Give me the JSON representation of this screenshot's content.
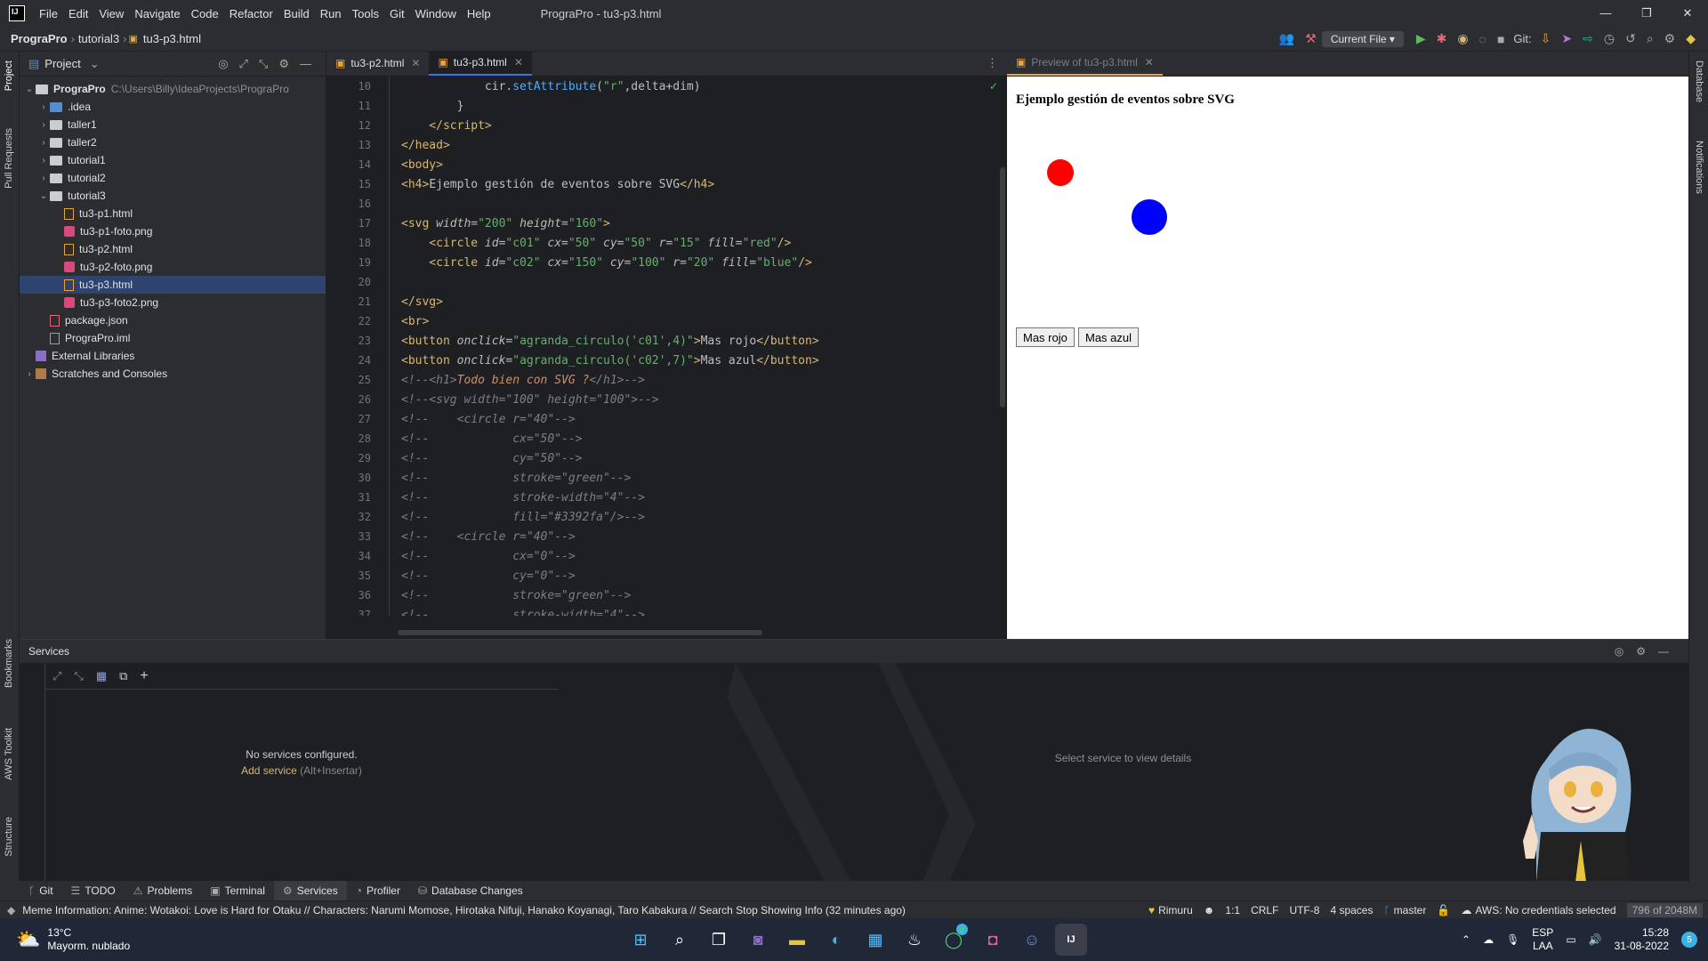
{
  "window": {
    "menu": [
      "File",
      "Edit",
      "View",
      "Navigate",
      "Code",
      "Refactor",
      "Build",
      "Run",
      "Tools",
      "Git",
      "Window",
      "Help"
    ],
    "title": "PrograPro - tu3-p3.html"
  },
  "nav": {
    "breadcrumb": [
      "PrograPro",
      "tutorial3",
      "tu3-p3.html"
    ],
    "run_config": "Current File",
    "git_label": "Git:"
  },
  "left_stripe": [
    "Project",
    "Pull Requests",
    "Bookmarks",
    "AWS Toolkit",
    "Structure"
  ],
  "right_stripe": [
    "Database",
    "Notifications"
  ],
  "project": {
    "header": "Project",
    "root": {
      "name": "PrograPro",
      "path": "C:\\Users\\Billy\\IdeaProjects\\PrograPro"
    },
    "items": [
      {
        "name": ".idea",
        "type": "folder-blue",
        "level": 1,
        "arrow": "›"
      },
      {
        "name": "taller1",
        "type": "folder",
        "level": 1,
        "arrow": "›"
      },
      {
        "name": "taller2",
        "type": "folder",
        "level": 1,
        "arrow": "›"
      },
      {
        "name": "tutorial1",
        "type": "folder",
        "level": 1,
        "arrow": "›"
      },
      {
        "name": "tutorial2",
        "type": "folder",
        "level": 1,
        "arrow": "›"
      },
      {
        "name": "tutorial3",
        "type": "folder",
        "level": 1,
        "arrow": "⌄"
      },
      {
        "name": "tu3-p1.html",
        "type": "html",
        "level": 2,
        "arrow": ""
      },
      {
        "name": "tu3-p1-foto.png",
        "type": "img",
        "level": 2,
        "arrow": ""
      },
      {
        "name": "tu3-p2.html",
        "type": "html",
        "level": 2,
        "arrow": ""
      },
      {
        "name": "tu3-p2-foto.png",
        "type": "img",
        "level": 2,
        "arrow": ""
      },
      {
        "name": "tu3-p3.html",
        "type": "html",
        "level": 2,
        "arrow": "",
        "selected": true
      },
      {
        "name": "tu3-p3-foto2.png",
        "type": "img",
        "level": 2,
        "arrow": ""
      },
      {
        "name": "package.json",
        "type": "json",
        "level": 1,
        "arrow": ""
      },
      {
        "name": "PrograPro.iml",
        "type": "iml",
        "level": 1,
        "arrow": ""
      },
      {
        "name": "External Libraries",
        "type": "lib",
        "level": 0,
        "arrow": ""
      },
      {
        "name": "Scratches and Consoles",
        "type": "scr",
        "level": 0,
        "arrow": "›"
      }
    ]
  },
  "editor": {
    "tabs": [
      {
        "label": "tu3-p2.html"
      },
      {
        "label": "tu3-p3.html",
        "active": true
      }
    ],
    "lines": [
      {
        "n": "10",
        "html": "<span class='js'>            cir.</span><span class='fn'>setAttribute</span><span class='js'>(</span><span class='str'>\"r\"</span><span class='js'>,delta+dim)</span>"
      },
      {
        "n": "11",
        "html": "<span class='js'>        }</span>"
      },
      {
        "n": "12",
        "html": "<span class='tag'>    &lt;/script&gt;</span>"
      },
      {
        "n": "13",
        "html": "<span class='tag'>&lt;/head&gt;</span>"
      },
      {
        "n": "14",
        "html": "<span class='tag'>&lt;body&gt;</span>"
      },
      {
        "n": "15",
        "html": "<span class='tag'>&lt;h4&gt;</span><span class='txt'>Ejemplo gestión de eventos sobre SVG</span><span class='tag'>&lt;/h4&gt;</span>"
      },
      {
        "n": "16",
        "html": ""
      },
      {
        "n": "17",
        "html": "<span class='tag'>&lt;svg </span><span class='attr'>width=</span><span class='str'>\"200\"</span><span class='attr'> height=</span><span class='str'>\"160\"</span><span class='tag'>&gt;</span>"
      },
      {
        "n": "18",
        "html": "<span class='tag'>    &lt;circle </span><span class='attr'>id=</span><span class='str'>\"c01\"</span><span class='attr'> cx=</span><span class='str'>\"50\"</span><span class='attr'> cy=</span><span class='str'>\"50\"</span><span class='attr'> r=</span><span class='str'>\"15\"</span><span class='attr'> fill=</span><span class='str'>\"red\"</span><span class='tag'>/&gt;</span>"
      },
      {
        "n": "19",
        "html": "<span class='tag'>    &lt;circle </span><span class='attr'>id=</span><span class='str'>\"c02\"</span><span class='attr'> cx=</span><span class='str'>\"150\"</span><span class='attr'> cy=</span><span class='str'>\"100\"</span><span class='attr'> r=</span><span class='str'>\"20\"</span><span class='attr'> fill=</span><span class='str'>\"blue\"</span><span class='tag'>/&gt;</span>"
      },
      {
        "n": "20",
        "html": ""
      },
      {
        "n": "21",
        "html": "<span class='tag'>&lt;/svg&gt;</span>"
      },
      {
        "n": "22",
        "html": "<span class='tag'>&lt;br&gt;</span>"
      },
      {
        "n": "23",
        "html": "<span class='tag'>&lt;button </span><span class='attr'>onclick=</span><span class='str'>\"agranda_circulo('c01',4)\"</span><span class='tag'>&gt;</span><span class='txt'>Mas rojo</span><span class='tag'>&lt;/button&gt;</span>"
      },
      {
        "n": "24",
        "html": "<span class='tag'>&lt;button </span><span class='attr'>onclick=</span><span class='str'>\"agranda_circulo('c02',7)\"</span><span class='tag'>&gt;</span><span class='txt'>Mas azul</span><span class='tag'>&lt;/button&gt;</span>"
      },
      {
        "n": "25",
        "html": "<span class='cmt'>&lt;!--&lt;h1&gt;</span><span class='em'>Todo bien con SVG ?</span><span class='cmt'>&lt;/h1&gt;--&gt;</span>"
      },
      {
        "n": "26",
        "html": "<span class='cmt'>&lt;!--&lt;svg width=\"100\" height=\"100\"&gt;--&gt;</span>"
      },
      {
        "n": "27",
        "html": "<span class='cmt'>&lt;!--    &lt;circle r=\"40\"--&gt;</span>"
      },
      {
        "n": "28",
        "html": "<span class='cmt'>&lt;!--            cx=\"50\"--&gt;</span>"
      },
      {
        "n": "29",
        "html": "<span class='cmt'>&lt;!--            cy=\"50\"--&gt;</span>"
      },
      {
        "n": "30",
        "html": "<span class='cmt'>&lt;!--            stroke=\"green\"--&gt;</span>"
      },
      {
        "n": "31",
        "html": "<span class='cmt'>&lt;!--            stroke-width=\"4\"--&gt;</span>"
      },
      {
        "n": "32",
        "html": "<span class='cmt'>&lt;!--            fill=\"#3392fa\"/&gt;--&gt;</span>"
      },
      {
        "n": "33",
        "html": "<span class='cmt'>&lt;!--    &lt;circle r=\"40\"--&gt;</span>"
      },
      {
        "n": "34",
        "html": "<span class='cmt'>&lt;!--            cx=\"0\"--&gt;</span>"
      },
      {
        "n": "35",
        "html": "<span class='cmt'>&lt;!--            cy=\"0\"--&gt;</span>"
      },
      {
        "n": "36",
        "html": "<span class='cmt'>&lt;!--            stroke=\"green\"--&gt;</span>"
      },
      {
        "n": "37",
        "html": "<span class='cmt'>&lt;!--            stroke-width=\"4\"--&gt;</span>"
      }
    ]
  },
  "preview": {
    "tab": "Preview of tu3-p3.html",
    "heading": "Ejemplo gestión de eventos sobre SVG",
    "btn_red": "Mas rojo",
    "btn_blue": "Mas azul",
    "circle_red": "#ff0000",
    "circle_blue": "#0000ff"
  },
  "services": {
    "title": "Services",
    "empty": "No services configured.",
    "add": "Add service",
    "add_shortcut": "(Alt+Insertar)",
    "detail": "Select service to view details"
  },
  "bottom_tools": [
    {
      "label": "Git",
      "icon": "git-icon"
    },
    {
      "label": "TODO",
      "icon": "todo-icon"
    },
    {
      "label": "Problems",
      "icon": "problems-icon"
    },
    {
      "label": "Terminal",
      "icon": "terminal-icon"
    },
    {
      "label": "Services",
      "icon": "services-icon",
      "active": true
    },
    {
      "label": "Profiler",
      "icon": "profiler-icon"
    },
    {
      "label": "Database Changes",
      "icon": "database-icon"
    }
  ],
  "status": {
    "message": "Meme Information:  Anime: Wotakoi: Love is Hard for Otaku // Characters: Narumi Momose, Hirotaka Nifuji, Hanako Koyanagi, Taro Kabakura // Search   Stop Showing Info (32 minutes ago)",
    "theme": "Rimuru",
    "position": "1:1",
    "line_sep": "CRLF",
    "encoding": "UTF-8",
    "indent": "4 spaces",
    "branch": "master",
    "aws": "AWS: No credentials selected",
    "memory": "796 of 2048M"
  },
  "taskbar": {
    "temp": "13°C",
    "weather": "Mayorm. nublado",
    "lang": "ESP",
    "lang2": "LAA",
    "time": "15:28",
    "date": "31-08-2022",
    "notif": "5",
    "whatsapp_badge": "8"
  }
}
